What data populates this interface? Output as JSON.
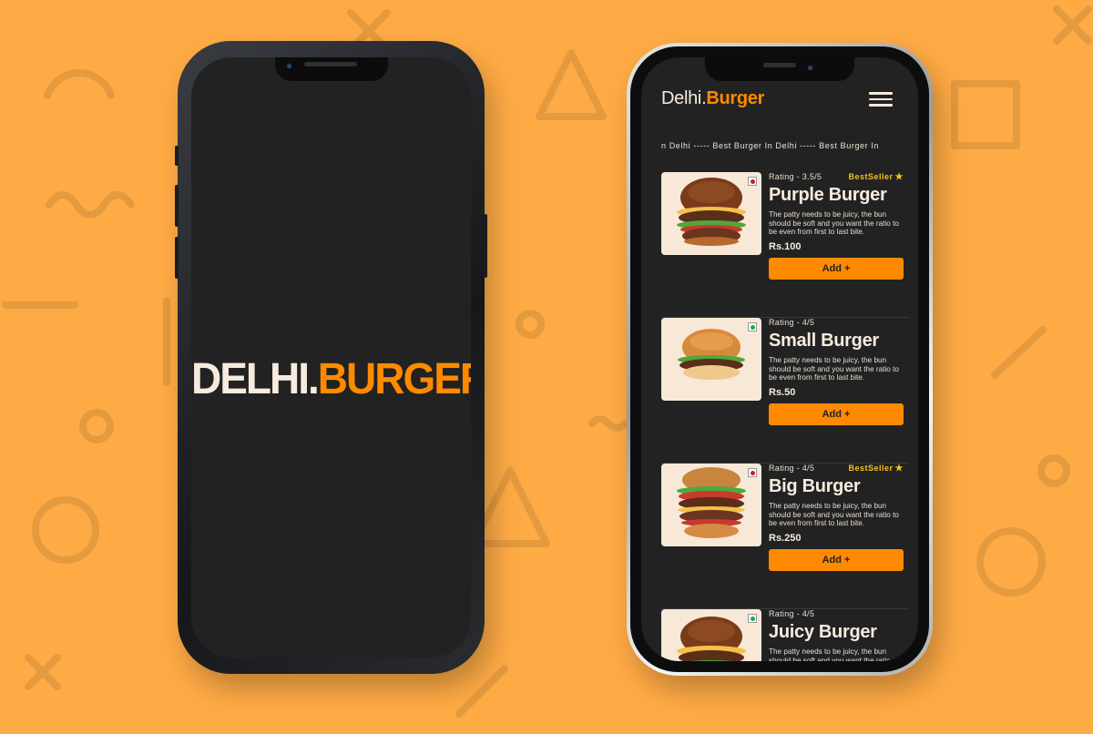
{
  "colors": {
    "background": "#FFAB45",
    "screen": "#222222",
    "accent": "#FF8A00",
    "cream": "#F6EBDD",
    "bestseller": "#F4C21B"
  },
  "splash": {
    "logo_part1": "DELHI.",
    "logo_part2": "BURGER"
  },
  "menu": {
    "brand_part1": "Delhi.",
    "brand_part2": "Burger",
    "menu_icon": "hamburger-menu-icon",
    "marquee": "n Delhi ----- Best Burger In Delhi ----- Best Burger In",
    "items": [
      {
        "name": "Purple Burger",
        "rating": "Rating - 3.5/5",
        "bestseller": "BestSeller",
        "description": "The patty needs to be juicy, the bun should be soft and you want the ratio to be even from first to last bite.",
        "price": "Rs.100",
        "button": "Add +",
        "food_type": "non-veg",
        "indicator_color": "#B8232F"
      },
      {
        "name": "Small Burger",
        "rating": "Rating - 4/5",
        "bestseller": "",
        "description": "The patty needs to be juicy, the bun should be soft and you want the ratio to be even from first to last bite.",
        "price": "Rs.50",
        "button": "Add +",
        "food_type": "veg",
        "indicator_color": "#1FA84A"
      },
      {
        "name": "Big Burger",
        "rating": "Rating - 4/5",
        "bestseller": "BestSeller",
        "description": "The patty needs to be juicy, the bun should be soft and you want the ratio to be even from first to last bite.",
        "price": "Rs.250",
        "button": "Add +",
        "food_type": "non-veg",
        "indicator_color": "#B8232F"
      },
      {
        "name": "Juicy Burger",
        "rating": "Rating - 4/5",
        "bestseller": "",
        "description": "The patty needs to be juicy, the bun should be soft and you want the ratio to be even from first to last bite.",
        "price": "",
        "button": "",
        "food_type": "veg",
        "indicator_color": "#1FA84A"
      }
    ]
  }
}
